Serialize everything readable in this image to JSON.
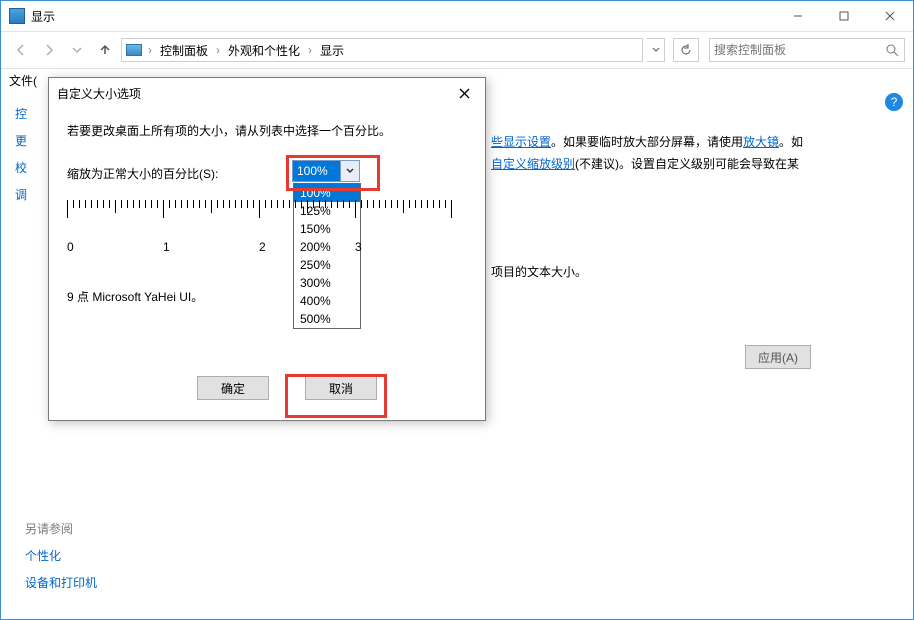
{
  "titlebar": {
    "title": "显示"
  },
  "nav": {
    "crumbs": [
      "控制面板",
      "外观和个性化",
      "显示"
    ],
    "search_placeholder": "搜索控制面板"
  },
  "menubar": {
    "file": "文件("
  },
  "leftnav": {
    "items": [
      "控",
      "更",
      "校",
      "调"
    ]
  },
  "content": {
    "link_display": "些显示设置",
    "frag1": "。如果要临时放大部分屏幕，请使用",
    "link_magnifier": "放大镜",
    "frag2": "。如",
    "link_custom": "自定义缩放级别",
    "frag3": "(不建议)。设置自定义级别可能会导致在某",
    "para2": "项目的文本大小。",
    "apply": "应用(A)"
  },
  "help": "?",
  "footer": {
    "header": "另请参阅",
    "links": [
      "个性化",
      "设备和打印机"
    ]
  },
  "dialog": {
    "title": "自定义大小选项",
    "desc": "若要更改桌面上所有项的大小，请从列表中选择一个百分比。",
    "scale_label": "缩放为正常大小的百分比(S):",
    "combo_value": "100%",
    "options": [
      "100%",
      "125%",
      "150%",
      "200%",
      "250%",
      "300%",
      "400%",
      "500%"
    ],
    "ruler_numbers": [
      "0",
      "1",
      "2",
      "3"
    ],
    "sample": "9 点 Microsoft YaHei UI。",
    "ok": "确定",
    "cancel": "取消"
  }
}
